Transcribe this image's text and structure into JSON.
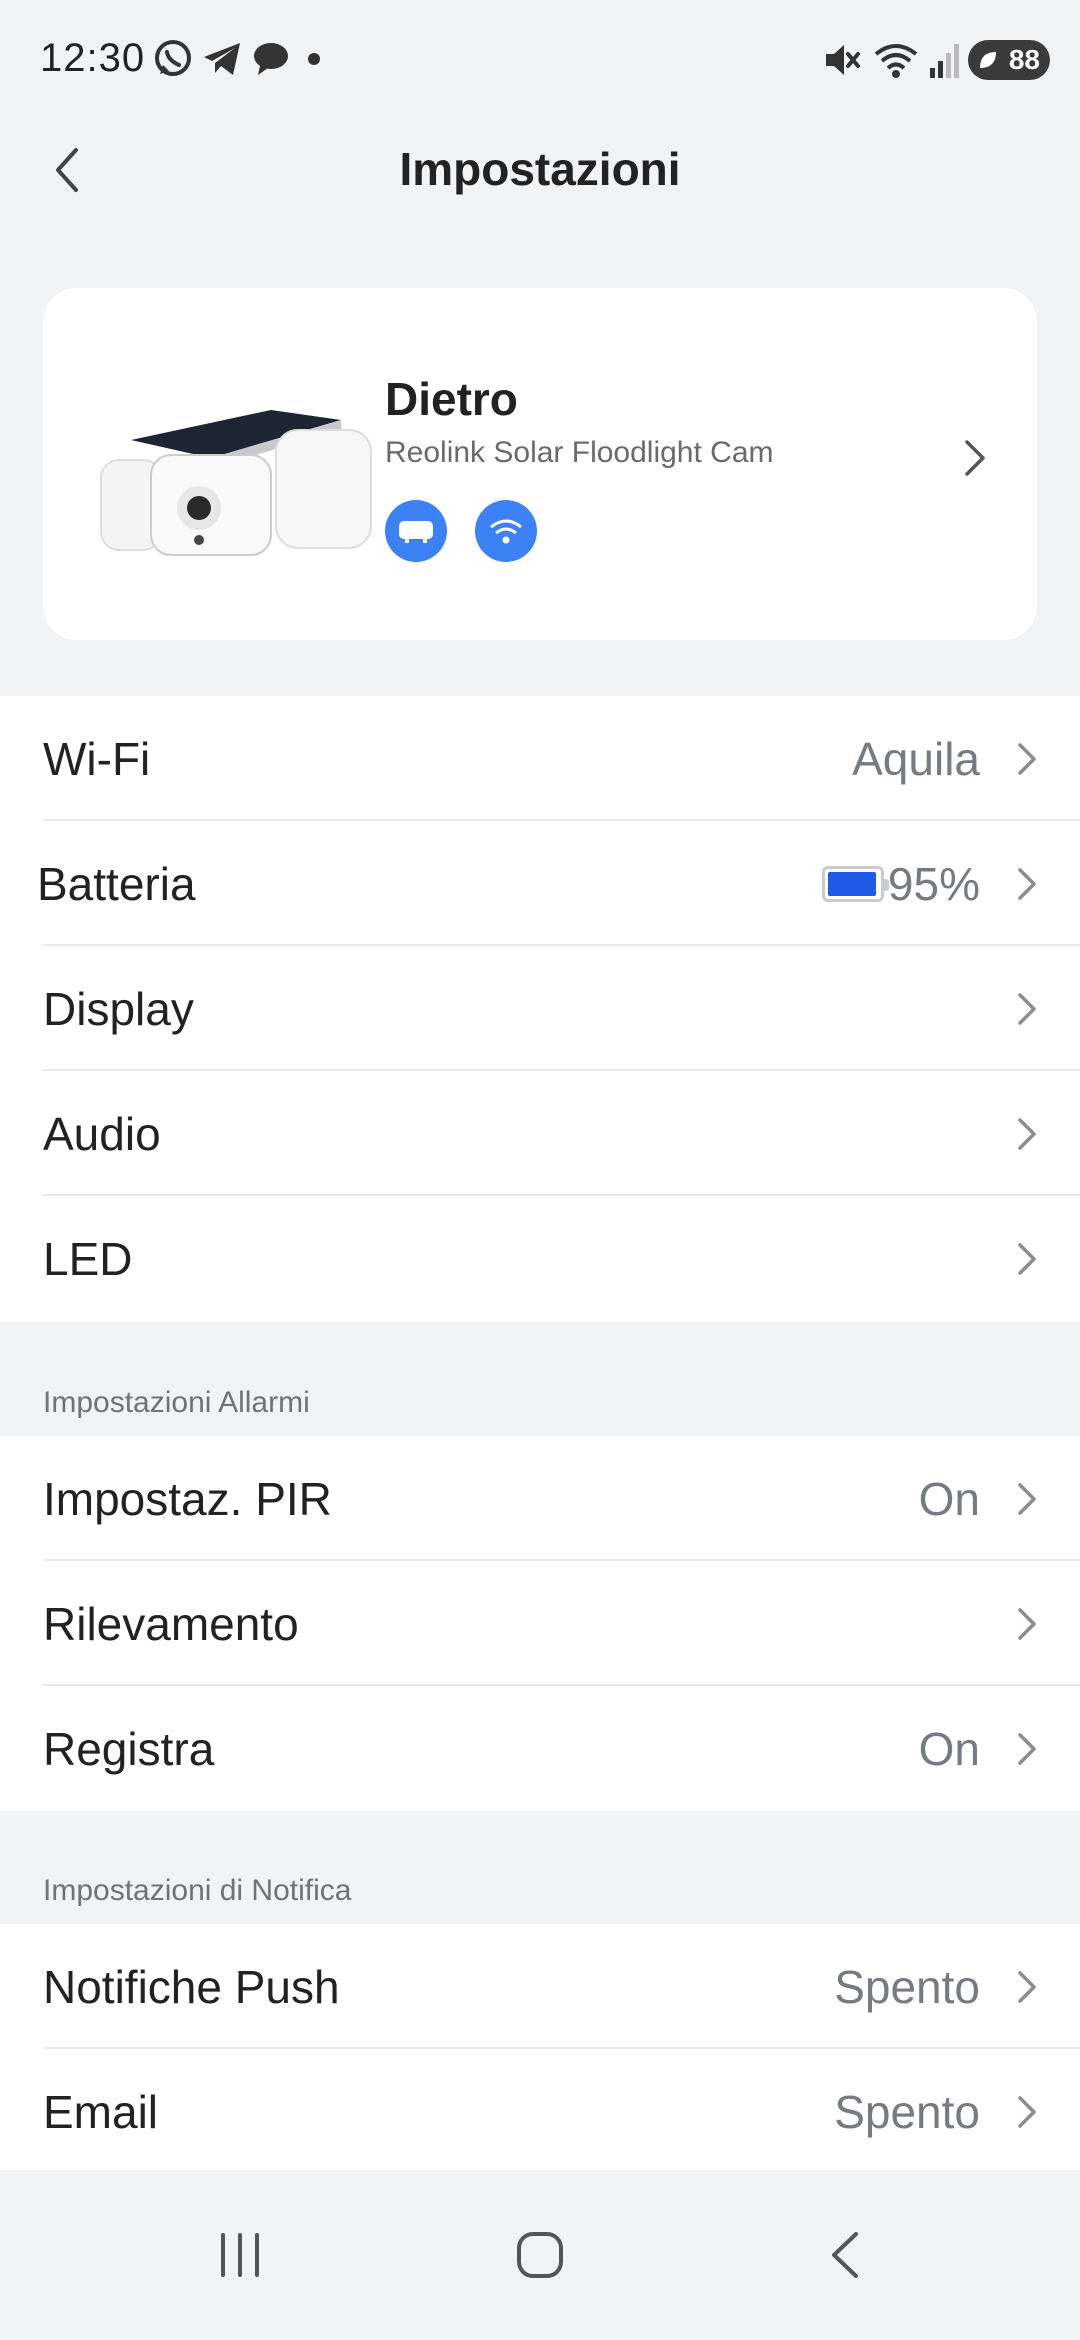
{
  "status_bar": {
    "time": "12:30",
    "icons_left": [
      "whatsapp-icon",
      "telegram-icon",
      "chat-icon",
      "dot-icon"
    ],
    "icons_right": [
      "mute-icon",
      "wifi-icon",
      "signal-icon"
    ],
    "battery": "88"
  },
  "header": {
    "title": "Impostazioni",
    "back_icon": "chevron-left-icon"
  },
  "device": {
    "name": "Dietro",
    "model": "Reolink Solar Floodlight Cam",
    "badges": [
      "floodlight-icon",
      "wifi-icon"
    ],
    "accent_color": "#3d82f5"
  },
  "general_settings": [
    {
      "label": "Wi-Fi",
      "value": "Aquila"
    },
    {
      "label": "Batteria",
      "value": "95%",
      "battery_level": 0.95
    },
    {
      "label": "Display",
      "value": ""
    },
    {
      "label": "Audio",
      "value": ""
    },
    {
      "label": "LED",
      "value": ""
    }
  ],
  "alarm_section": {
    "title": "Impostazioni Allarmi",
    "items": [
      {
        "label": "Impostaz. PIR",
        "value": "On"
      },
      {
        "label": "Rilevamento",
        "value": ""
      },
      {
        "label": "Registra",
        "value": "On"
      }
    ]
  },
  "notification_section": {
    "title": "Impostazioni di Notifica",
    "items": [
      {
        "label": "Notifiche Push",
        "value": "Spento"
      },
      {
        "label": "Email",
        "value": "Spento"
      }
    ]
  },
  "nav_bar": [
    "recents-icon",
    "home-icon",
    "back-icon"
  ]
}
